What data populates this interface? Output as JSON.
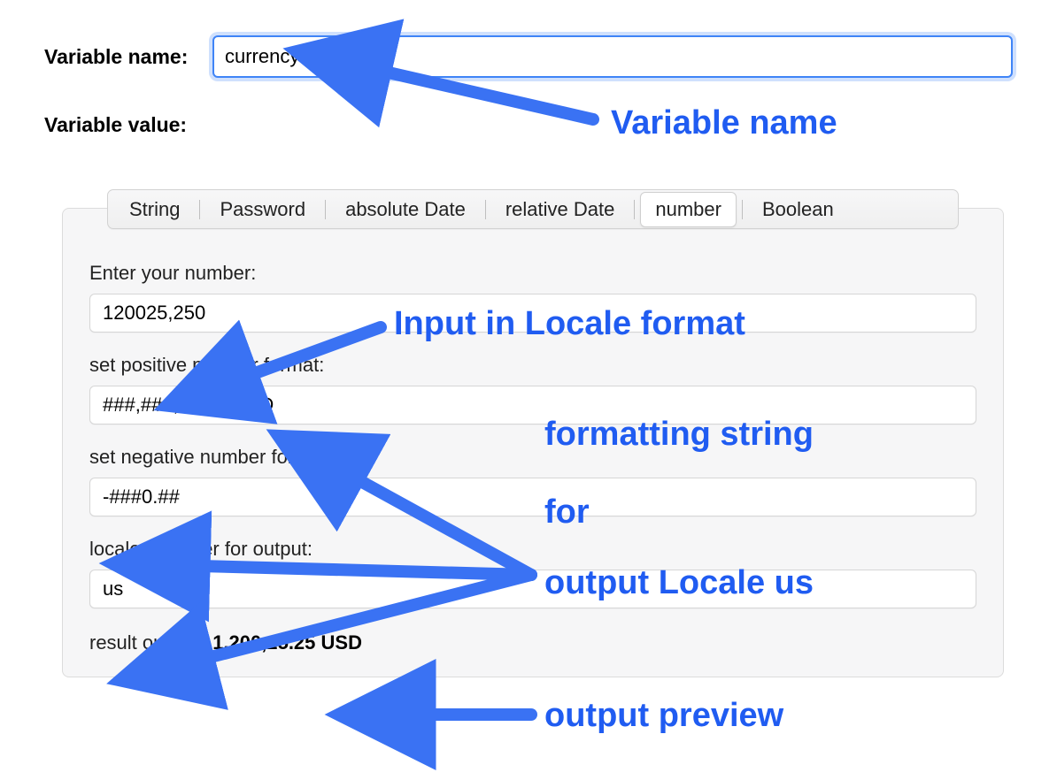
{
  "variable_name_label": "Variable name:",
  "variable_name_value": "currencyvalue",
  "variable_value_label": "Variable value:",
  "tabs": {
    "string": "String",
    "password": "Password",
    "absolute_date": "absolute Date",
    "relative_date": "relative Date",
    "number": "number",
    "boolean": "Boolean"
  },
  "active_tab": "number",
  "fields": {
    "enter_number_label": "Enter your number:",
    "enter_number_value": "120025,250",
    "positive_format_label": "set positive number format:",
    "positive_format_value": "###,###,##.## USD",
    "negative_format_label": "set negative number format:",
    "negative_format_value": "-###0.##",
    "locale_label": "locale identifier for output:",
    "locale_value": "us",
    "result_label": "result output:",
    "result_value": "1,200,25.25 USD"
  },
  "annotations": {
    "variable_name": "Variable name",
    "input_locale": "Input in Locale format",
    "formatting_line1": "formatting string",
    "formatting_line2": "for",
    "formatting_line3": "output Locale us",
    "output_preview": "output preview"
  },
  "colors": {
    "annotation": "#205cf1",
    "focus_border": "#3f84f7",
    "panel_bg": "#f6f6f7"
  }
}
